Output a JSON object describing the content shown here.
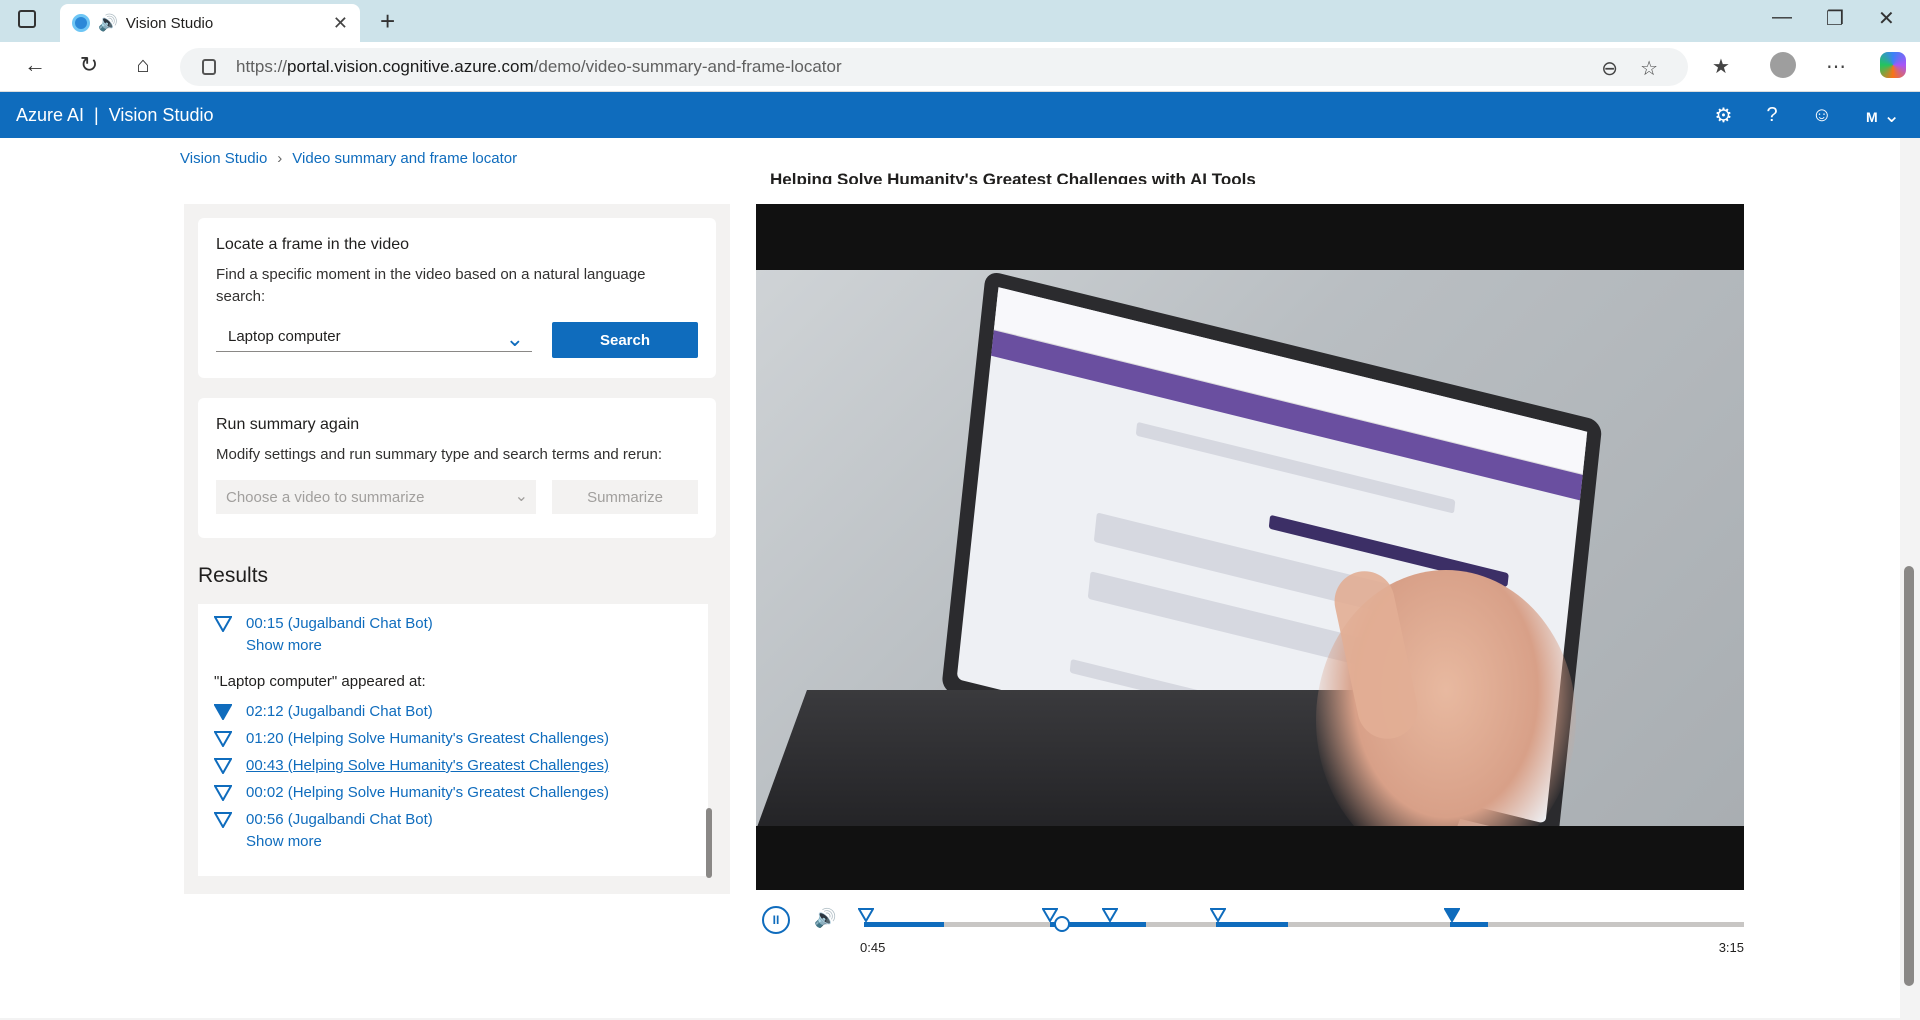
{
  "browser": {
    "tab_title": "Vision Studio",
    "url_prefix": "https://",
    "url_host": "portal.vision.cognitive.azure.com",
    "url_path": "/demo/video-summary-and-frame-locator"
  },
  "app": {
    "brand": "Azure AI",
    "separator": "|",
    "product": "Vision Studio",
    "user_initial": "M"
  },
  "breadcrumb": {
    "root": "Vision Studio",
    "current": "Video summary and frame locator"
  },
  "locate": {
    "title": "Locate a frame in the video",
    "description": "Find a specific moment in the video based on a natural language search:",
    "query": "Laptop computer",
    "search_label": "Search"
  },
  "rerun": {
    "title": "Run summary again",
    "description": "Modify settings and run summary type and search terms and rerun:",
    "video_placeholder": "Choose a video to summarize",
    "summarize_label": "Summarize"
  },
  "results": {
    "heading": "Results",
    "prev_item": "00:15 (Jugalbandi Chat Bot)",
    "show_more": "Show more",
    "appeared_heading": "\"Laptop computer\" appeared at:",
    "items": [
      "02:12 (Jugalbandi Chat Bot)",
      "01:20 (Helping Solve Humanity's Greatest Challenges)",
      "00:43 (Helping Solve Humanity's Greatest Challenges)",
      "00:02 (Helping Solve Humanity's Greatest Challenges)",
      "00:56 (Jugalbandi Chat Bot)"
    ],
    "show_more_2": "Show more"
  },
  "video": {
    "title": "Helping Solve Humanity's Greatest Challenges with AI Tools",
    "current_time": "0:45",
    "duration": "3:15"
  },
  "colors": {
    "accent": "#0f6cbd",
    "browser_tabbar": "#cde3ea"
  }
}
